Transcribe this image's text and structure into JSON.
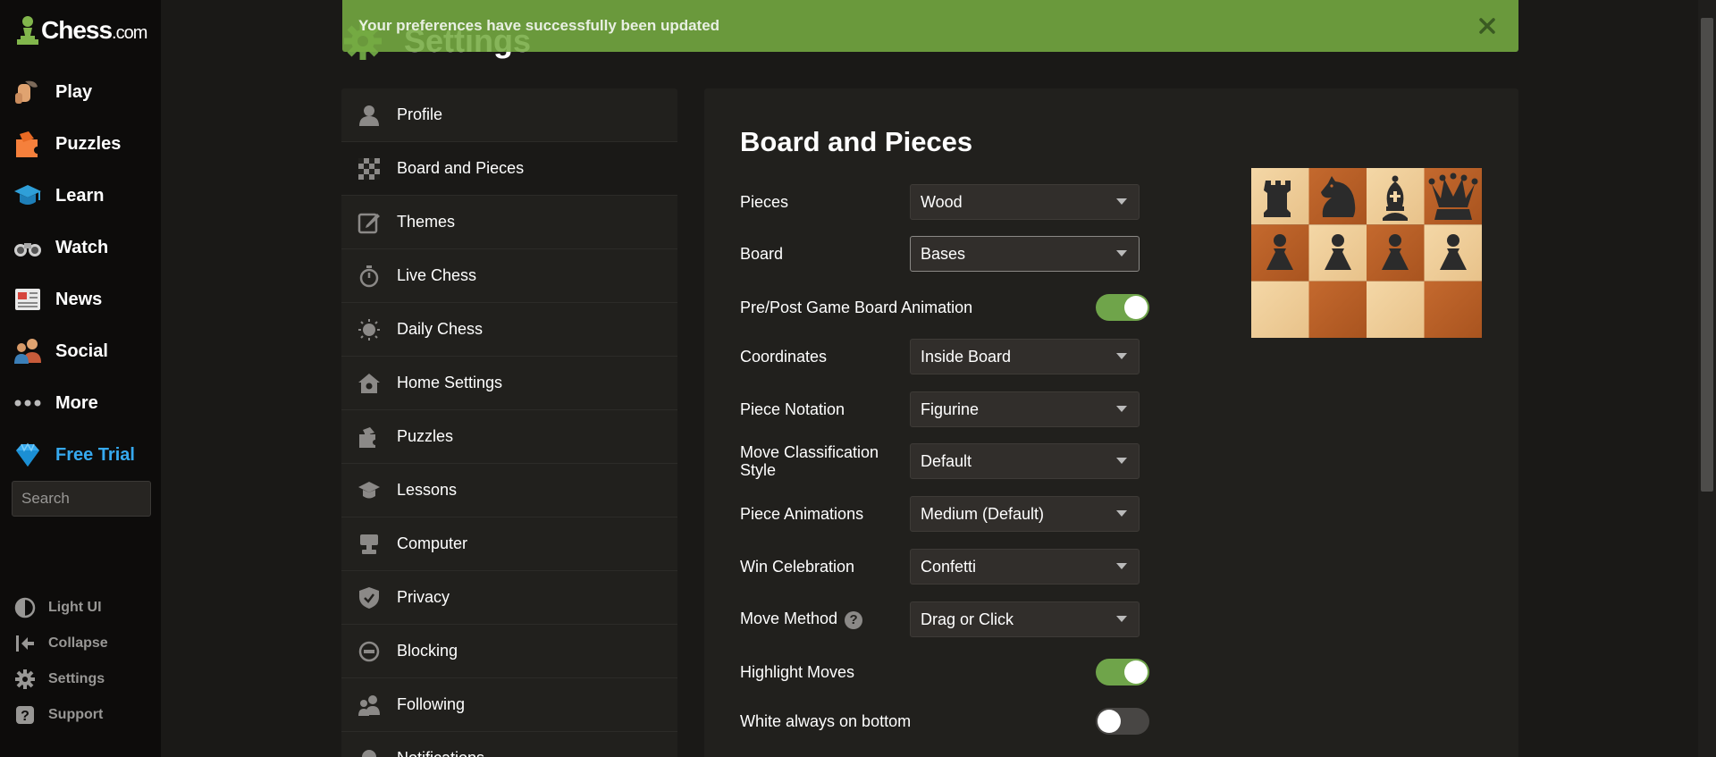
{
  "brand": {
    "name": "Chess",
    "domain": ".com"
  },
  "nav": {
    "items": [
      {
        "label": "Play",
        "icon": "play-hand-icon"
      },
      {
        "label": "Puzzles",
        "icon": "puzzle-icon"
      },
      {
        "label": "Learn",
        "icon": "graduation-cap-icon"
      },
      {
        "label": "Watch",
        "icon": "binoculars-icon"
      },
      {
        "label": "News",
        "icon": "newspaper-icon"
      },
      {
        "label": "Social",
        "icon": "people-icon"
      },
      {
        "label": "More",
        "icon": "more-dots-icon"
      },
      {
        "label": "Free Trial",
        "icon": "diamond-icon"
      }
    ],
    "search_placeholder": "Search",
    "bottom": [
      {
        "label": "Light UI",
        "icon": "contrast-icon"
      },
      {
        "label": "Collapse",
        "icon": "collapse-arrow-icon"
      },
      {
        "label": "Settings",
        "icon": "gear-icon"
      },
      {
        "label": "Support",
        "icon": "question-icon"
      }
    ]
  },
  "toast": {
    "message": "Your preferences have successfully been updated"
  },
  "page": {
    "title": "Settings"
  },
  "settings_menu": [
    {
      "label": "Profile",
      "icon": "profile-icon"
    },
    {
      "label": "Board and Pieces",
      "icon": "checkerboard-icon",
      "active": true
    },
    {
      "label": "Themes",
      "icon": "edit-icon"
    },
    {
      "label": "Live Chess",
      "icon": "stopwatch-icon"
    },
    {
      "label": "Daily Chess",
      "icon": "sun-icon"
    },
    {
      "label": "Home Settings",
      "icon": "home-gear-icon"
    },
    {
      "label": "Puzzles",
      "icon": "puzzle-icon"
    },
    {
      "label": "Lessons",
      "icon": "graduation-cap-icon"
    },
    {
      "label": "Computer",
      "icon": "computer-icon"
    },
    {
      "label": "Privacy",
      "icon": "shield-icon"
    },
    {
      "label": "Blocking",
      "icon": "block-icon"
    },
    {
      "label": "Following",
      "icon": "following-icon"
    },
    {
      "label": "Notifications",
      "icon": "bell-icon"
    }
  ],
  "panel": {
    "title": "Board and Pieces",
    "settings": {
      "pieces": {
        "label": "Pieces",
        "value": "Wood"
      },
      "board": {
        "label": "Board",
        "value": "Bases"
      },
      "animation": {
        "label": "Pre/Post Game Board Animation",
        "on": true
      },
      "coordinates": {
        "label": "Coordinates",
        "value": "Inside Board"
      },
      "notation": {
        "label": "Piece Notation",
        "value": "Figurine"
      },
      "classification": {
        "label": "Move Classification Style",
        "value": "Default"
      },
      "piece_animations": {
        "label": "Piece Animations",
        "value": "Medium (Default)"
      },
      "win_celebration": {
        "label": "Win Celebration",
        "value": "Confetti"
      },
      "move_method": {
        "label": "Move Method",
        "value": "Drag or Click",
        "help": "?"
      },
      "highlight_moves": {
        "label": "Highlight Moves",
        "on": true
      },
      "white_bottom": {
        "label": "White always on bottom",
        "on": false
      }
    }
  },
  "colors": {
    "accent_green": "#75ab42",
    "trial_blue": "#36a9ef",
    "background": "#1a1917",
    "panel": "#21201d"
  }
}
